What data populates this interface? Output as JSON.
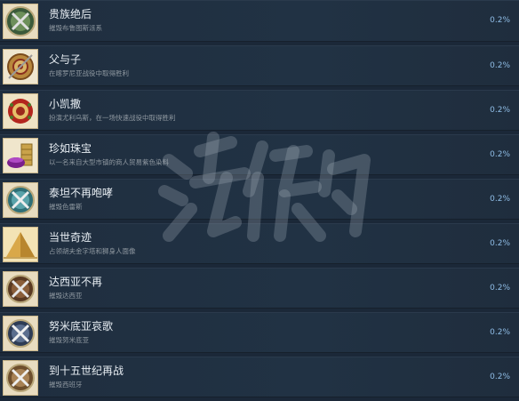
{
  "achievements": [
    {
      "title": "贵族绝后",
      "desc": "摧毁布鲁图斯派系",
      "percent": "0.2%",
      "icon": "crossed-swords-green-icon"
    },
    {
      "title": "父与子",
      "desc": "在喀罗尼亚战役中取得胜利",
      "percent": "0.2%",
      "icon": "patterned-shield-icon"
    },
    {
      "title": "小凯撒",
      "desc": "扮演尤利乌斯，在一场快速战役中取得胜利",
      "percent": "0.2%",
      "icon": "laurel-wreath-icon"
    },
    {
      "title": "珍如珠宝",
      "desc": "以一名来自大型市镇的商人贸易紫色染料",
      "percent": "0.2%",
      "icon": "purple-dye-coins-icon"
    },
    {
      "title": "泰坦不再咆哮",
      "desc": "摧毁色雷斯",
      "percent": "0.2%",
      "icon": "crossed-swords-teal-icon"
    },
    {
      "title": "当世奇迹",
      "desc": "占领胡夫金字塔和狮身人面像",
      "percent": "0.2%",
      "icon": "pyramid-icon"
    },
    {
      "title": "达西亚不再",
      "desc": "摧毁达西亚",
      "percent": "0.2%",
      "icon": "crossed-swords-brown-icon"
    },
    {
      "title": "努米底亚哀歌",
      "desc": "摧毁努米底亚",
      "percent": "0.2%",
      "icon": "crossed-swords-grey-icon"
    },
    {
      "title": "到十五世纪再战",
      "desc": "摧毁西班牙",
      "percent": "0.2%",
      "icon": "crossed-swords-tan-icon"
    }
  ],
  "watermark_text": "游侠网"
}
